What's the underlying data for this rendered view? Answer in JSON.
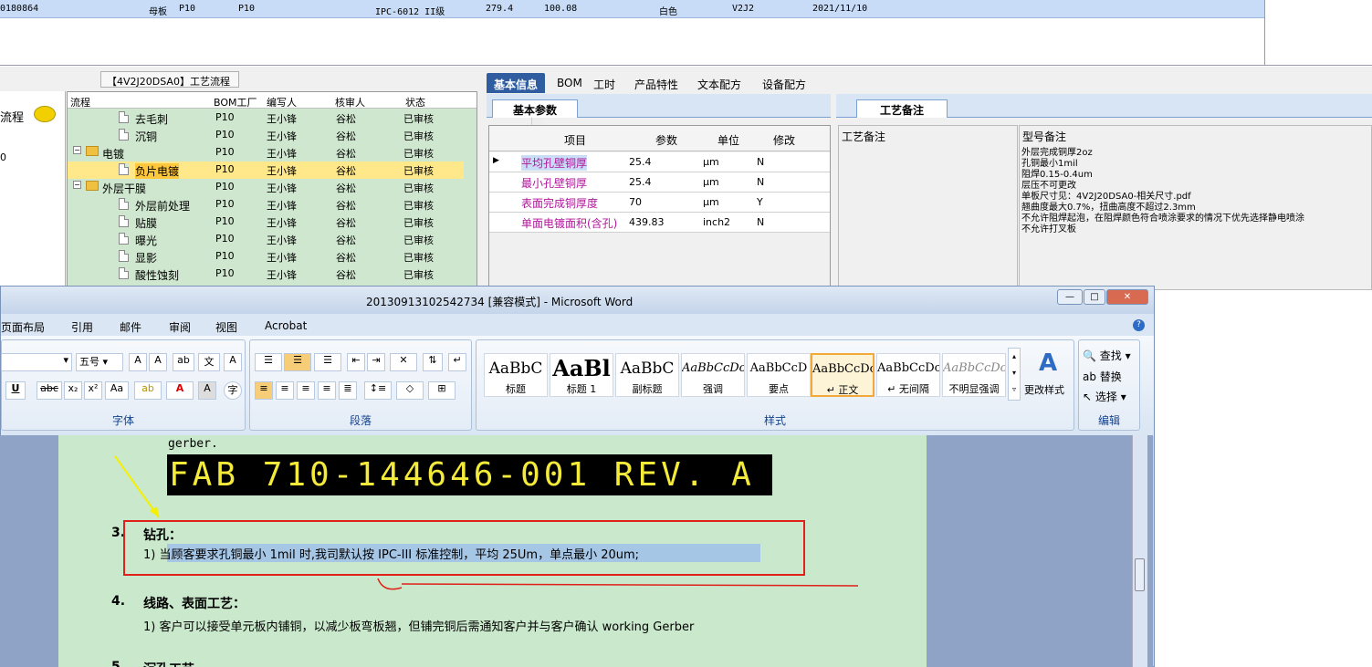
{
  "top_grid": {
    "row": {
      "id": "0180864",
      "type": "母板",
      "c3": "P10",
      "c4": "P10",
      "grade": "IPC-6012 II级",
      "v1": "279.4",
      "v2": "100.08",
      "color": "白色",
      "ver": "V2J2",
      "date": "2021/11/10"
    }
  },
  "left_panel": {
    "label": "流程",
    "extra": "0"
  },
  "tree": {
    "title": "【4V2J20DSA0】工艺流程",
    "headers": [
      "流程",
      "BOM工厂",
      "编写人",
      "核审人",
      "状态"
    ],
    "rows": [
      {
        "name": "去毛刺",
        "factory": "P10",
        "writer": "王小锋",
        "reviewer": "谷松",
        "status": "已审核",
        "kind": "file",
        "level": 2
      },
      {
        "name": "沉铜",
        "factory": "P10",
        "writer": "王小锋",
        "reviewer": "谷松",
        "status": "已审核",
        "kind": "file",
        "level": 2
      },
      {
        "name": "电镀",
        "factory": "P10",
        "writer": "王小锋",
        "reviewer": "谷松",
        "status": "已审核",
        "kind": "folder",
        "level": 1
      },
      {
        "name": "负片电镀",
        "factory": "P10",
        "writer": "王小锋",
        "reviewer": "谷松",
        "status": "已审核",
        "kind": "file",
        "level": 2,
        "selected": true
      },
      {
        "name": "外层干膜",
        "factory": "P10",
        "writer": "王小锋",
        "reviewer": "谷松",
        "status": "已审核",
        "kind": "folder",
        "level": 1
      },
      {
        "name": "外层前处理",
        "factory": "P10",
        "writer": "王小锋",
        "reviewer": "谷松",
        "status": "已审核",
        "kind": "file",
        "level": 2
      },
      {
        "name": "贴膜",
        "factory": "P10",
        "writer": "王小锋",
        "reviewer": "谷松",
        "status": "已审核",
        "kind": "file",
        "level": 2
      },
      {
        "name": "曝光",
        "factory": "P10",
        "writer": "王小锋",
        "reviewer": "谷松",
        "status": "已审核",
        "kind": "file",
        "level": 2
      },
      {
        "name": "显影",
        "factory": "P10",
        "writer": "王小锋",
        "reviewer": "谷松",
        "status": "已审核",
        "kind": "file",
        "level": 2
      },
      {
        "name": "酸性蚀刻",
        "factory": "P10",
        "writer": "王小锋",
        "reviewer": "谷松",
        "status": "已审核",
        "kind": "file",
        "level": 2
      }
    ]
  },
  "tabs": [
    "基本信息",
    "BOM",
    "工时",
    "产品特性",
    "文本配方",
    "设备配方"
  ],
  "basic_params": {
    "tab": "基本参数",
    "headers": [
      "项目",
      "参数",
      "单位",
      "修改"
    ],
    "rows": [
      {
        "item": "平均孔壁铜厚",
        "value": "25.4",
        "unit": "μm",
        "mod": "N"
      },
      {
        "item": "最小孔壁铜厚",
        "value": "25.4",
        "unit": "μm",
        "mod": "N"
      },
      {
        "item": "表面完成铜厚度",
        "value": "70",
        "unit": "μm",
        "mod": "Y"
      },
      {
        "item": "单面电镀面积(含孔)",
        "value": "439.83",
        "unit": "inch2",
        "mod": "N"
      }
    ]
  },
  "notes": {
    "tab": "工艺备注",
    "col1": "工艺备注",
    "col2": "型号备注",
    "lines": [
      "外层完成铜厚2oz",
      "孔铜最小1mil",
      "阻焊0.15-0.4um",
      "层压不可更改",
      "单板尺寸见：4V2J20DSA0-相关尺寸.pdf",
      "翘曲度最大0.7%，扭曲高度不超过2.3mm",
      "不允许阻焊起泡，在阻焊颜色符合喷涂要求的情况下优先选择静电喷涂",
      "不允许打叉板"
    ]
  },
  "word": {
    "title": "20130913102542734 [兼容模式] - Microsoft Word",
    "menu": [
      "页面布局",
      "引用",
      "邮件",
      "审阅",
      "视图",
      "Acrobat"
    ],
    "font_size": "五号",
    "group_labels": {
      "font": "字体",
      "paragraph": "段落",
      "styles": "样式",
      "editing": "编辑"
    },
    "styles": [
      {
        "preview": "AaBbC",
        "name": "标题"
      },
      {
        "preview": "AaBl",
        "name": "标题 1"
      },
      {
        "preview": "AaBbC",
        "name": "副标题"
      },
      {
        "preview": "AaBbCcDc",
        "name": "强调"
      },
      {
        "preview": "AaBbCcD",
        "name": "要点"
      },
      {
        "preview": "AaBbCcDc",
        "name": "↵ 正文"
      },
      {
        "preview": "AaBbCcDc",
        "name": "↵ 无间隔"
      },
      {
        "preview": "AaBbCcDc",
        "name": "不明显强调"
      }
    ],
    "change_styles": "更改样式",
    "editing": {
      "find": "查找",
      "replace": "替换",
      "select": "选择"
    },
    "doc": {
      "gerber": "gerber.",
      "fab": "FAB 710-144646-001 REV. A",
      "s3_num": "3.",
      "s3_title": "钻孔：",
      "s3_item": "1)  当顾客要求孔铜最小 1mil 时,我司默认按 IPC-III 标准控制，平均 25Um，单点最小 20um;",
      "s4_num": "4.",
      "s4_title": "线路、表面工艺：",
      "s4_item": "1)  客户可以接受单元板内铺铜，以减少板弯板翘，但铺完铜后需通知客户并与客户确认 working Gerber",
      "s5_num": "5.",
      "s5_title": "沉孔工艺"
    }
  },
  "colors": {
    "accent": "#2f5d9f",
    "tree_bg": "#cfe6cf",
    "page_bg": "#cae8cb",
    "highlight": "#ffc83c",
    "annotation_red": "#e0201a",
    "arrow_yellow": "#f4f000"
  }
}
